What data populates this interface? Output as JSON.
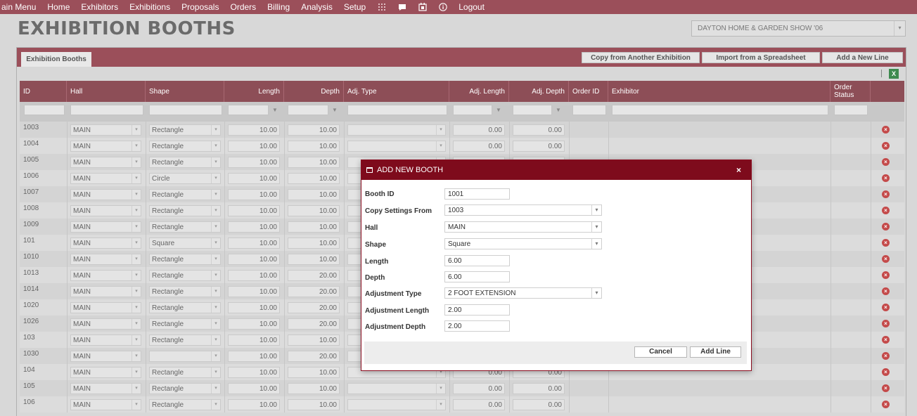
{
  "menu": [
    "ain Menu",
    "Home",
    "Exhibitors",
    "Exhibitions",
    "Proposals",
    "Orders",
    "Billing",
    "Analysis",
    "Setup"
  ],
  "menu_icons": [
    "grid-icon",
    "chat-icon",
    "calendar-icon",
    "info-icon"
  ],
  "logout": "Logout",
  "page_title": "EXHIBITION BOOTHS",
  "exhibition_select": "DAYTON HOME & GARDEN SHOW '06",
  "tab": "Exhibition Booths",
  "buttons": {
    "copy": "Copy from Another Exhibition",
    "import": "Import from a Spreadsheet",
    "add_line": "Add a New Line"
  },
  "columns": {
    "id": "ID",
    "hall": "Hall",
    "shape": "Shape",
    "length": "Length",
    "depth": "Depth",
    "adj_type": "Adj. Type",
    "adj_length": "Adj. Length",
    "adj_depth": "Adj. Depth",
    "order_id": "Order ID",
    "exhibitor": "Exhibitor",
    "order_status": "Order Status"
  },
  "rows": [
    {
      "id": "1003",
      "hall": "MAIN",
      "shape": "Rectangle",
      "length": "10.00",
      "depth": "10.00",
      "adj_length": "0.00",
      "adj_depth": "0.00"
    },
    {
      "id": "1004",
      "hall": "MAIN",
      "shape": "Rectangle",
      "length": "10.00",
      "depth": "10.00",
      "adj_length": "0.00",
      "adj_depth": "0.00"
    },
    {
      "id": "1005",
      "hall": "MAIN",
      "shape": "Rectangle",
      "length": "10.00",
      "depth": "10.00",
      "adj_length": "",
      "adj_depth": ""
    },
    {
      "id": "1006",
      "hall": "MAIN",
      "shape": "Circle",
      "length": "10.00",
      "depth": "10.00",
      "adj_length": "",
      "adj_depth": ""
    },
    {
      "id": "1007",
      "hall": "MAIN",
      "shape": "Rectangle",
      "length": "10.00",
      "depth": "10.00",
      "adj_length": "",
      "adj_depth": ""
    },
    {
      "id": "1008",
      "hall": "MAIN",
      "shape": "Rectangle",
      "length": "10.00",
      "depth": "10.00",
      "adj_length": "",
      "adj_depth": ""
    },
    {
      "id": "1009",
      "hall": "MAIN",
      "shape": "Rectangle",
      "length": "10.00",
      "depth": "10.00",
      "adj_length": "",
      "adj_depth": ""
    },
    {
      "id": "101",
      "hall": "MAIN",
      "shape": "Square",
      "length": "10.00",
      "depth": "10.00",
      "adj_length": "",
      "adj_depth": ""
    },
    {
      "id": "1010",
      "hall": "MAIN",
      "shape": "Rectangle",
      "length": "10.00",
      "depth": "10.00",
      "adj_length": "",
      "adj_depth": ""
    },
    {
      "id": "1013",
      "hall": "MAIN",
      "shape": "Rectangle",
      "length": "10.00",
      "depth": "20.00",
      "adj_length": "",
      "adj_depth": ""
    },
    {
      "id": "1014",
      "hall": "MAIN",
      "shape": "Rectangle",
      "length": "10.00",
      "depth": "20.00",
      "adj_length": "",
      "adj_depth": ""
    },
    {
      "id": "1020",
      "hall": "MAIN",
      "shape": "Rectangle",
      "length": "10.00",
      "depth": "20.00",
      "adj_length": "",
      "adj_depth": ""
    },
    {
      "id": "1026",
      "hall": "MAIN",
      "shape": "Rectangle",
      "length": "10.00",
      "depth": "20.00",
      "adj_length": "",
      "adj_depth": ""
    },
    {
      "id": "103",
      "hall": "MAIN",
      "shape": "Rectangle",
      "length": "10.00",
      "depth": "10.00",
      "adj_length": "",
      "adj_depth": ""
    },
    {
      "id": "1030",
      "hall": "MAIN",
      "shape": "",
      "length": "10.00",
      "depth": "20.00",
      "adj_length": "",
      "adj_depth": ""
    },
    {
      "id": "104",
      "hall": "MAIN",
      "shape": "Rectangle",
      "length": "10.00",
      "depth": "10.00",
      "adj_length": "0.00",
      "adj_depth": "0.00"
    },
    {
      "id": "105",
      "hall": "MAIN",
      "shape": "Rectangle",
      "length": "10.00",
      "depth": "10.00",
      "adj_length": "0.00",
      "adj_depth": "0.00"
    },
    {
      "id": "106",
      "hall": "MAIN",
      "shape": "Rectangle",
      "length": "10.00",
      "depth": "10.00",
      "adj_length": "0.00",
      "adj_depth": "0.00"
    }
  ],
  "modal": {
    "title": "ADD NEW BOOTH",
    "close": "×",
    "fields": {
      "booth_id": {
        "label": "Booth ID",
        "value": "1001"
      },
      "copy_from": {
        "label": "Copy Settings From",
        "value": "1003"
      },
      "hall": {
        "label": "Hall",
        "value": "MAIN"
      },
      "shape": {
        "label": "Shape",
        "value": "Square"
      },
      "length": {
        "label": "Length",
        "value": "6.00"
      },
      "depth": {
        "label": "Depth",
        "value": "6.00"
      },
      "adj_type": {
        "label": "Adjustment Type",
        "value": "2 FOOT EXTENSION"
      },
      "adj_length": {
        "label": "Adjustment Length",
        "value": "2.00"
      },
      "adj_depth": {
        "label": "Adjustment Depth",
        "value": "2.00"
      }
    },
    "cancel": "Cancel",
    "add_line": "Add Line"
  },
  "colors": {
    "brand": "#9b4f5a",
    "modal_header": "#7e0b1c",
    "delete": "#c44a4a"
  }
}
